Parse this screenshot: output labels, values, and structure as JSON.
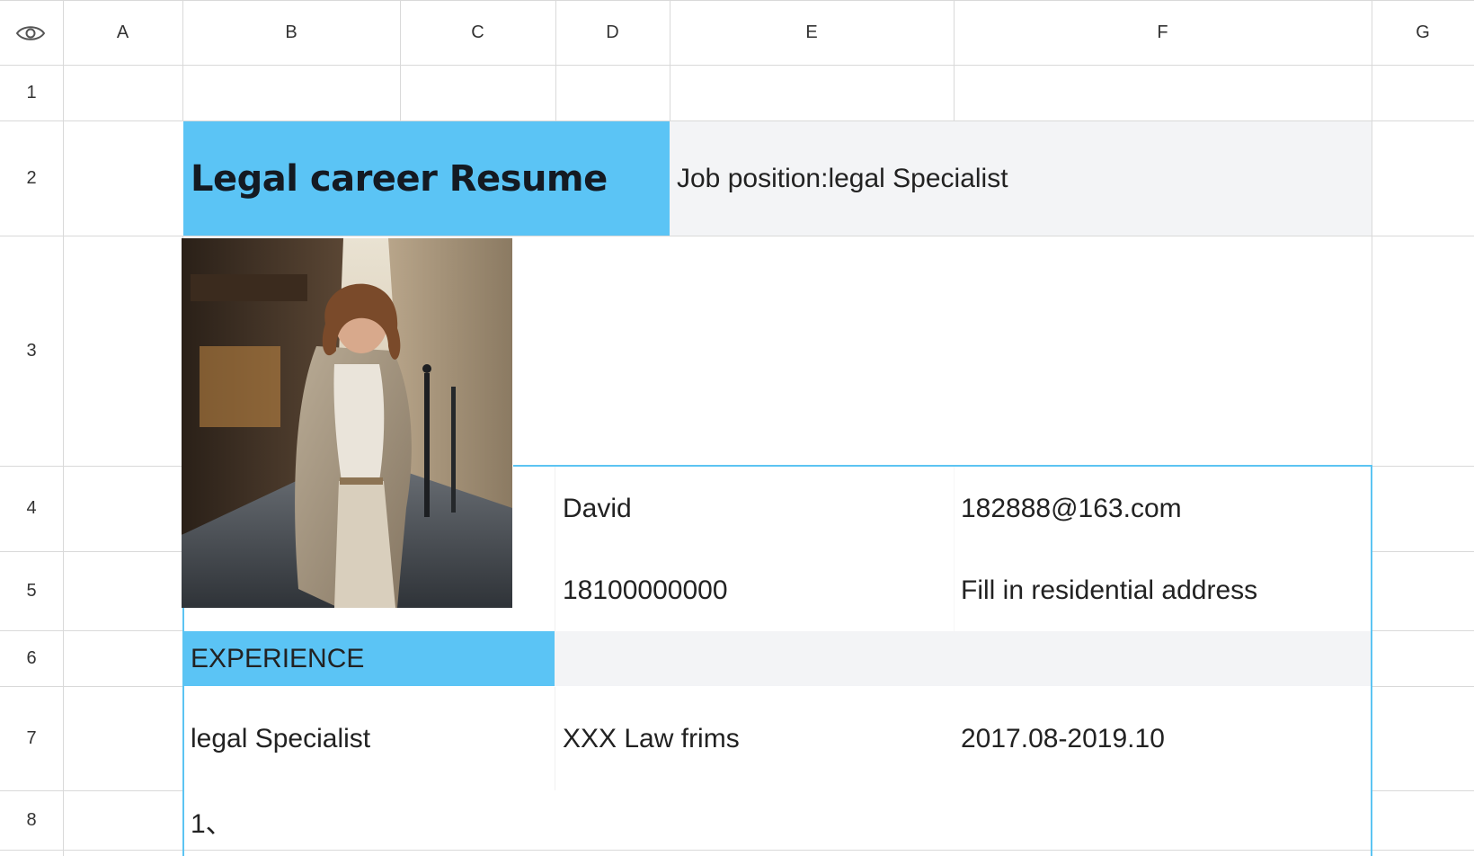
{
  "sheet": {
    "columns": [
      "A",
      "B",
      "C",
      "D",
      "E",
      "F",
      "G"
    ],
    "rows": [
      "1",
      "2",
      "3",
      "4",
      "5",
      "6",
      "7",
      "8"
    ]
  },
  "resume": {
    "title": "Legal career Resume",
    "job_position": "Job position:legal Specialist",
    "name": "David",
    "email": "182888@163.com",
    "phone": "18100000000",
    "address": "Fill in residential address",
    "experience_heading": "EXPERIENCE",
    "experience_role": "legal Specialist",
    "experience_company": "XXX Law frims",
    "experience_dates": "2017.08-2019.10",
    "item_number": "1、"
  },
  "colors": {
    "accent_blue": "#5bc4f5",
    "light_gray_fill": "#f3f4f6",
    "grid_line": "#d9d9d9",
    "selection_border": "#5cc4f2"
  },
  "icons": {
    "visibility_toggle": "eye-icon",
    "photo": "portrait-photo"
  }
}
